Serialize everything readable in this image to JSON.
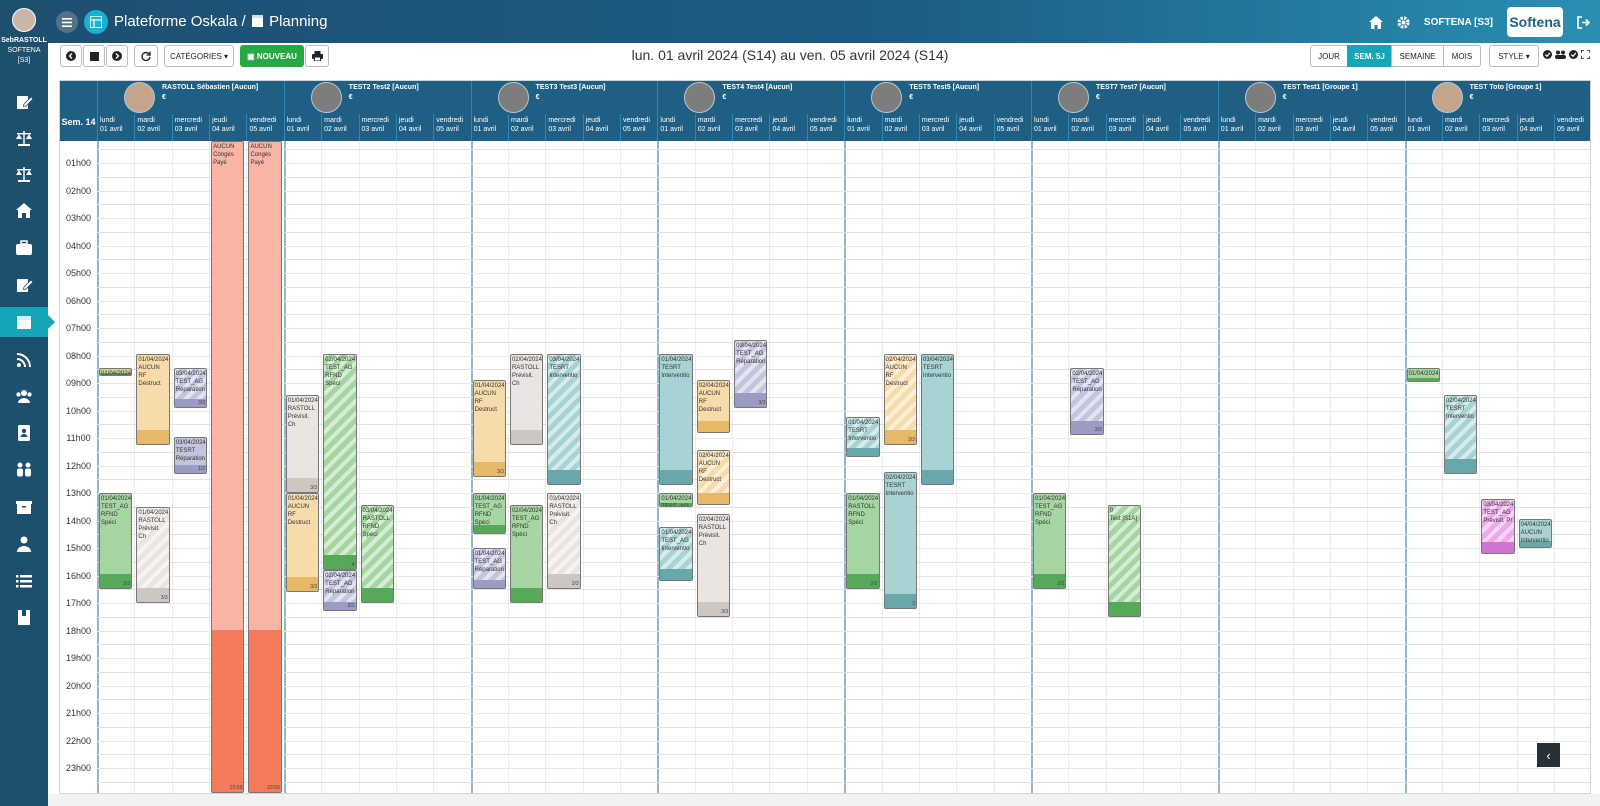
{
  "user": {
    "name": "SebRASTOLL",
    "company": "SOFTENA",
    "code": "[S3]"
  },
  "header": {
    "app_title": "Plateforme Oskala /",
    "page_title": "Planning",
    "company_label": "SOFTENA [S3]",
    "logo_text": "Softena"
  },
  "nav_icons": [
    "edit-icon",
    "balance-icon",
    "balance-icon",
    "home-icon",
    "briefcase-icon",
    "edit-icon",
    "calendar-icon",
    "rss-icon",
    "users-icon",
    "contact-icon",
    "group-icon",
    "box-icon",
    "person-icon",
    "list-icon",
    "book-icon"
  ],
  "toolbar": {
    "categories_label": "CATÉGORIES",
    "new_label": "NOUVEAU",
    "date_range": "lun. 01 avril 2024 (S14) au ven. 05 avril 2024 (S14)",
    "views": [
      "JOUR",
      "SEM. 5J",
      "SEMAINE",
      "MOIS"
    ],
    "active_view": "SEM. 5J",
    "style_label": "STYLE"
  },
  "week_label": "Sem. 14",
  "people": [
    {
      "name": "RASTOLL Sébastien [Aucun]",
      "euro": "€"
    },
    {
      "name": "TEST2 Test2 [Aucun]",
      "euro": "€"
    },
    {
      "name": "TEST3 Test3 [Aucun]",
      "euro": "€"
    },
    {
      "name": "TEST4 Test4 [Aucun]",
      "euro": "€"
    },
    {
      "name": "TEST5 Test5 [Aucun]",
      "euro": "€"
    },
    {
      "name": "TEST7 Test7 [Aucun]",
      "euro": "€"
    },
    {
      "name": "TEST Test1 [Groupe 1]",
      "euro": "€"
    },
    {
      "name": "TEST Toto [Groupe 1]",
      "euro": "€"
    }
  ],
  "days": [
    {
      "dow": "lundi",
      "date": "01 avril"
    },
    {
      "dow": "mardi",
      "date": "02 avril"
    },
    {
      "dow": "mercredi",
      "date": "03 avril"
    },
    {
      "dow": "jeudi",
      "date": "04 avril"
    },
    {
      "dow": "vendredi",
      "date": "05 avril"
    }
  ],
  "hours": [
    "01h00",
    "02h00",
    "03h00",
    "04h00",
    "05h00",
    "06h00",
    "07h00",
    "08h00",
    "09h00",
    "10h00",
    "11h00",
    "12h00",
    "13h00",
    "14h00",
    "15h00",
    "16h00",
    "17h00",
    "18h00",
    "19h00",
    "20h00",
    "21h00",
    "22h00",
    "23h00"
  ],
  "colors": {
    "salmon": "#f9b4a5",
    "salmon_dark": "#f47a5c",
    "yellow": "#f7dbab",
    "yellow_dark": "#e7b867",
    "green": "#a5d6a2",
    "green_dark": "#57a95a",
    "teal": "#a8d3d4",
    "teal_dark": "#6aa7aa",
    "grey": "#ebe5e2",
    "grey_dark": "#d0c6c1",
    "purple": "#c3c4de",
    "purple_dark": "#9a9cc4",
    "pink": "#f0a6ec",
    "pink_dark": "#d372d0",
    "olive": "#cfd09b"
  },
  "events": [
    {
      "p": 0,
      "d": 0,
      "s": 8.45,
      "e": 8.75,
      "color": "olive",
      "striped": false,
      "text": "01/04/2024",
      "count": ""
    },
    {
      "p": 0,
      "d": 0,
      "s": 13.0,
      "e": 16.5,
      "color": "green",
      "striped": false,
      "text": "01/04/2024\nTEST_AG\nRFND Spéci",
      "count": "2/2"
    },
    {
      "p": 0,
      "d": 1,
      "s": 7.95,
      "e": 11.25,
      "color": "yellow",
      "striped": false,
      "text": "01/04/2024\nAUCUN\nRF Destruct",
      "count": ""
    },
    {
      "p": 0,
      "d": 1,
      "s": 13.5,
      "e": 17.0,
      "color": "grey",
      "striped": true,
      "text": "01/04/2024\nRASTOLL\nPrévisit. Ch",
      "count": "3/3"
    },
    {
      "p": 0,
      "d": 2,
      "s": 8.45,
      "e": 9.9,
      "color": "purple",
      "striped": true,
      "text": "03/04/2024\nTEST_AG\nRéparation",
      "count": "3/3"
    },
    {
      "p": 0,
      "d": 2,
      "s": 10.95,
      "e": 12.3,
      "color": "purple",
      "striped": false,
      "text": "03/04/2024\nTESRT\nRéparation",
      "count": "1/2"
    },
    {
      "p": 0,
      "d": 3,
      "s": -0.3,
      "e": 23.95,
      "color": "salmon",
      "striped": false,
      "text": "AUCUN\nCongès Payé",
      "count": "23:59"
    },
    {
      "p": 0,
      "d": 4,
      "s": -0.3,
      "e": 23.95,
      "color": "salmon",
      "striped": false,
      "text": "AUCUN\nCongès Payé",
      "count": "23:59"
    },
    {
      "p": 1,
      "d": 0,
      "s": 9.45,
      "e": 13.0,
      "color": "grey",
      "striped": false,
      "text": "01/04/2024\nRASTOLL\nPrévisit. Ch",
      "count": "3/3"
    },
    {
      "p": 1,
      "d": 0,
      "s": 13.0,
      "e": 16.6,
      "color": "yellow",
      "striped": false,
      "text": "01/04/2024\nAUCUN\nRF Destruct",
      "count": "3/3"
    },
    {
      "p": 1,
      "d": 1,
      "s": 7.95,
      "e": 15.8,
      "color": "green",
      "striped": true,
      "text": "02/04/2024\nTEST_AG\nRFND Spéci",
      "count": "4"
    },
    {
      "p": 1,
      "d": 1,
      "s": 15.8,
      "e": 17.3,
      "color": "purple",
      "striped": true,
      "text": "02/04/2024\nTEST_AG\nRéparation",
      "count": "3/3"
    },
    {
      "p": 1,
      "d": 2,
      "s": 13.45,
      "e": 17.0,
      "color": "green",
      "striped": true,
      "text": "03/04/2024\nRASTOLL\nRFND Spéci",
      "count": ""
    },
    {
      "p": 2,
      "d": 0,
      "s": 8.9,
      "e": 12.4,
      "color": "yellow",
      "striped": false,
      "text": "01/04/2024\nAUCUN\nRF Destruct",
      "count": "3/3"
    },
    {
      "p": 2,
      "d": 0,
      "s": 13.0,
      "e": 14.5,
      "color": "green",
      "striped": false,
      "text": "01/04/2024\nTEST_AG\nRFND Spéci",
      "count": ""
    },
    {
      "p": 2,
      "d": 0,
      "s": 15.0,
      "e": 16.5,
      "color": "purple",
      "striped": true,
      "text": "01/04/2024\nTEST_AG\nRéparation",
      "count": ""
    },
    {
      "p": 2,
      "d": 1,
      "s": 7.95,
      "e": 11.25,
      "color": "grey",
      "striped": false,
      "text": "02/04/2024\nRASTOLL\nPrévisit. Ch",
      "count": ""
    },
    {
      "p": 2,
      "d": 1,
      "s": 13.45,
      "e": 17.0,
      "color": "green",
      "striped": false,
      "text": "02/04/2024\nTEST_AG\nRFND Spéci",
      "count": ""
    },
    {
      "p": 2,
      "d": 2,
      "s": 7.95,
      "e": 12.7,
      "color": "teal",
      "striped": true,
      "text": "03/04/2024\nTESRT\nInterventio",
      "count": ""
    },
    {
      "p": 2,
      "d": 2,
      "s": 13.0,
      "e": 16.5,
      "color": "grey",
      "striped": true,
      "text": "03/04/2024\nRASTOLL\nPrévisit. Ch",
      "count": "3/3"
    },
    {
      "p": 3,
      "d": 0,
      "s": 7.95,
      "e": 12.7,
      "color": "teal",
      "striped": false,
      "text": "01/04/2024\nTESRT\nInterventio",
      "count": ""
    },
    {
      "p": 3,
      "d": 0,
      "s": 13.0,
      "e": 13.5,
      "color": "green",
      "striped": false,
      "text": "01/04/2024\nTEST_AG",
      "count": ""
    },
    {
      "p": 3,
      "d": 0,
      "s": 14.25,
      "e": 16.2,
      "color": "teal",
      "striped": true,
      "text": "01/04/2024\nTEST_AG\nInterventio",
      "count": ""
    },
    {
      "p": 3,
      "d": 1,
      "s": 8.9,
      "e": 10.8,
      "color": "yellow",
      "striped": false,
      "text": "02/04/2024\nAUCUN\nRF Destruct",
      "count": ""
    },
    {
      "p": 3,
      "d": 1,
      "s": 11.45,
      "e": 13.45,
      "color": "yellow",
      "striped": true,
      "text": "02/04/2024\nAUCUN\nRF Destruct",
      "count": ""
    },
    {
      "p": 3,
      "d": 1,
      "s": 13.75,
      "e": 17.5,
      "color": "grey",
      "striped": false,
      "text": "02/04/2024\nRASTOLL\nPrévisit. Ch",
      "count": "3/3"
    },
    {
      "p": 3,
      "d": 2,
      "s": 7.45,
      "e": 9.9,
      "color": "purple",
      "striped": true,
      "text": "03/04/2024\nTEST_AG\nRéparation",
      "count": "3/3"
    },
    {
      "p": 4,
      "d": 0,
      "s": 10.25,
      "e": 11.7,
      "color": "teal",
      "striped": true,
      "text": "01/04/2024\nTESRT\nInterventio",
      "count": ""
    },
    {
      "p": 4,
      "d": 0,
      "s": 13.0,
      "e": 16.5,
      "color": "green",
      "striped": false,
      "text": "01/04/2024\nRASTOLL\nRFND Spéci",
      "count": "2/2"
    },
    {
      "p": 4,
      "d": 1,
      "s": 7.95,
      "e": 11.25,
      "color": "yellow",
      "striped": true,
      "text": "02/04/2024\nAUCUN\nRF Destruct",
      "count": "3/3"
    },
    {
      "p": 4,
      "d": 1,
      "s": 12.25,
      "e": 17.2,
      "color": "teal",
      "striped": false,
      "text": "02/04/2024\nTESRT\nInterventio",
      "count": "3"
    },
    {
      "p": 4,
      "d": 2,
      "s": 7.95,
      "e": 12.7,
      "color": "teal",
      "striped": false,
      "text": "03/04/2024\nTESRT\nInterventio",
      "count": ""
    },
    {
      "p": 5,
      "d": 0,
      "s": 13.0,
      "e": 16.5,
      "color": "green",
      "striped": false,
      "text": "01/04/2024\nTEST_AG\nRFND Spéci",
      "count": "2/2"
    },
    {
      "p": 5,
      "d": 1,
      "s": 8.45,
      "e": 10.9,
      "color": "purple",
      "striped": true,
      "text": "02/04/2024\nTEST_AG\nRéparation",
      "count": "3/3"
    },
    {
      "p": 5,
      "d": 2,
      "s": 13.45,
      "e": 17.5,
      "color": "green",
      "striped": true,
      "text": "0\nTest [S1A]",
      "count": ""
    },
    {
      "p": 7,
      "d": 0,
      "s": 8.45,
      "e": 8.95,
      "color": "green",
      "striped": false,
      "text": "01/04/2024",
      "count": ""
    },
    {
      "p": 7,
      "d": 1,
      "s": 9.45,
      "e": 12.3,
      "color": "teal",
      "striped": true,
      "text": "02/04/2024\nTESRT\nInterventio",
      "count": ""
    },
    {
      "p": 7,
      "d": 2,
      "s": 13.2,
      "e": 15.2,
      "color": "pink",
      "striped": true,
      "text": "03/04/2024\nTEST_AG\nPrévisit. Pr",
      "count": ""
    },
    {
      "p": 7,
      "d": 3,
      "s": 13.95,
      "e": 15.0,
      "color": "teal",
      "striped": false,
      "text": "04/04/2024\nAUCUN\nInterventio",
      "count": ""
    }
  ]
}
